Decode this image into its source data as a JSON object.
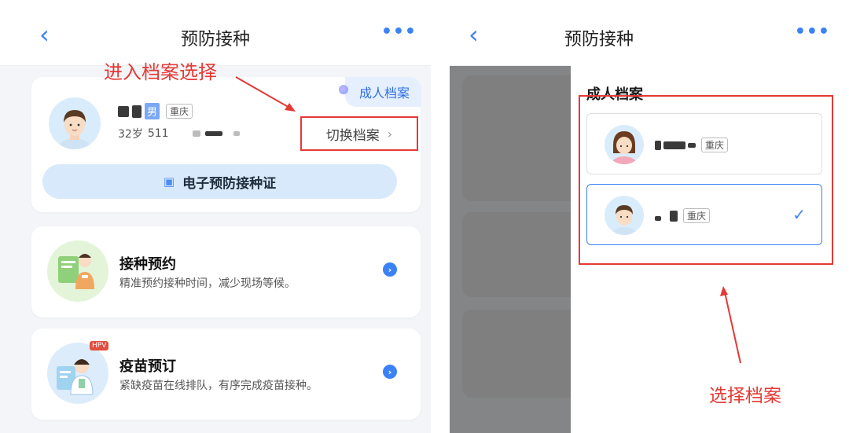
{
  "left": {
    "nav": {
      "back_icon": "‹",
      "title": "预防接种",
      "more_icon": "•••"
    },
    "annotation": "进入档案选择",
    "profile": {
      "archive_tag": "成人档案",
      "gender": "男",
      "location": "重庆",
      "age": "32岁",
      "id_prefix": "511",
      "switch_label": "切换档案",
      "switch_chevron": "›",
      "cert_icon": "▣",
      "cert_label": "电子预防接种证"
    },
    "services": [
      {
        "title": "接种预约",
        "desc": "精准预约接种时间，减少现场等候。",
        "go_icon": "›"
      },
      {
        "title": "疫苗预订",
        "desc": "紧缺疫苗在线排队，有序完成疫苗接种。",
        "badge": "HPV",
        "go_icon": "›"
      }
    ]
  },
  "right": {
    "nav": {
      "back_icon": "‹",
      "title": "预防接种",
      "more_icon": "•••"
    },
    "drawer_title": "成人档案",
    "options": [
      {
        "location": "重庆",
        "selected": false
      },
      {
        "location": "重庆",
        "selected": true,
        "check_icon": "✓"
      }
    ],
    "annotation": "选择档案"
  },
  "colors": {
    "accent": "#3b82f6",
    "annotation_red": "#e53935",
    "tag_bg": "#e5efff",
    "cert_bg": "#d8e9fc"
  }
}
